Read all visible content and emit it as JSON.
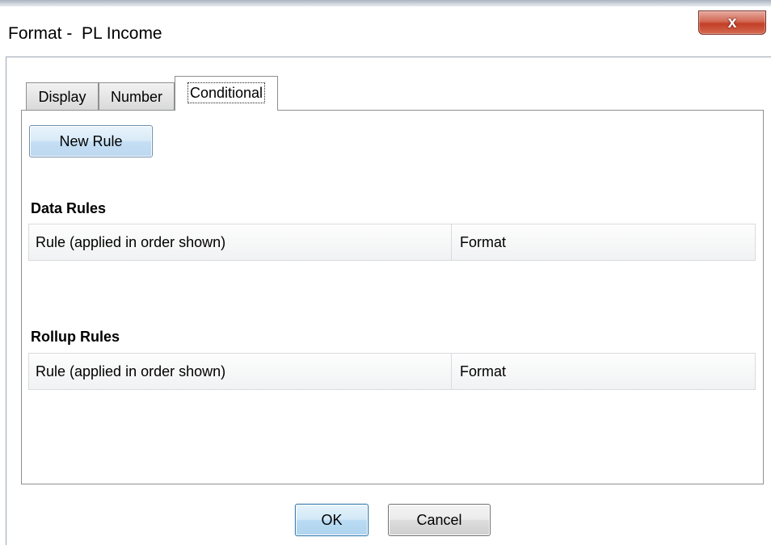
{
  "window": {
    "title": "Format -  PL Income",
    "close_glyph": "x"
  },
  "tabs": [
    {
      "label": "Display",
      "active": false
    },
    {
      "label": "Number",
      "active": false
    },
    {
      "label": "Conditional",
      "active": true
    }
  ],
  "toolbar": {
    "new_rule_label": "New Rule"
  },
  "data_rules": {
    "title": "Data Rules",
    "columns": [
      "Rule (applied in order shown)",
      "Format"
    ],
    "rows": []
  },
  "rollup_rules": {
    "title": "Rollup Rules",
    "columns": [
      "Rule (applied in order shown)",
      "Format"
    ],
    "rows": []
  },
  "footer": {
    "ok_label": "OK",
    "cancel_label": "Cancel"
  },
  "colors": {
    "close_button": "#c94a33",
    "primary_button": "#b9daf2",
    "panel_border": "#8e8f8f"
  },
  "icons": {
    "close": "close-icon"
  }
}
